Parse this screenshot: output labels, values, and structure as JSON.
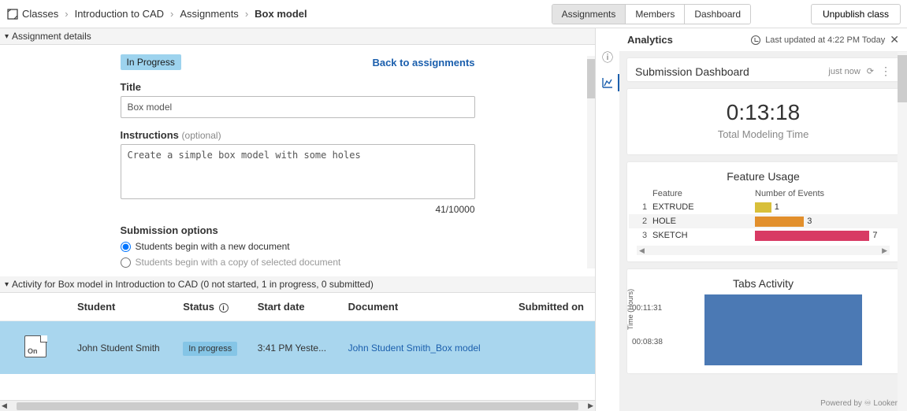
{
  "breadcrumb": {
    "root": "Classes",
    "course": "Introduction to CAD",
    "section": "Assignments",
    "current": "Box model"
  },
  "topTabs": {
    "assignments": "Assignments",
    "members": "Members",
    "dashboard": "Dashboard"
  },
  "unpublish": "Unpublish class",
  "sectionHeads": {
    "details": "Assignment details",
    "activity": "Activity for Box model in Introduction to CAD (0 not started, 1 in progress, 0 submitted)"
  },
  "details": {
    "status": "In Progress",
    "back": "Back to assignments",
    "titleLabel": "Title",
    "titleValue": "Box model",
    "instrLabel": "Instructions",
    "instrOpt": "(optional)",
    "instrValue": "Create a simple box model with some holes",
    "counter": "41/10000",
    "subOptsLabel": "Submission options",
    "radio1": "Students begin with a new document",
    "radio2": "Students begin with a copy of selected document"
  },
  "table": {
    "cols": {
      "student": "Student",
      "status": "Status",
      "start": "Start date",
      "document": "Document",
      "submitted": "Submitted on"
    },
    "row": {
      "student": "John Student Smith",
      "status": "In progress",
      "start": "3:41 PM Yeste...",
      "document": "John Student Smith_Box model"
    }
  },
  "analytics": {
    "title": "Analytics",
    "updated": "Last updated at 4:22 PM Today",
    "dash": {
      "title": "Submission Dashboard",
      "meta": "just now"
    },
    "time": {
      "value": "0:13:18",
      "label": "Total Modeling Time"
    },
    "feature": {
      "title": "Feature Usage",
      "colFeature": "Feature",
      "colEvents": "Number of Events"
    },
    "tabs": {
      "title": "Tabs Activity",
      "y1": "00:11:31",
      "y2": "00:08:38",
      "axis": "Time (Hours)"
    },
    "powered": "Powered by ♾ Looker"
  },
  "chart_data": {
    "type": "bar",
    "title": "Feature Usage",
    "xlabel": "Feature",
    "ylabel": "Number of Events",
    "categories": [
      "EXTRUDE",
      "HOLE",
      "SKETCH"
    ],
    "values": [
      1,
      3,
      7
    ],
    "colors": [
      "#d8bf3a",
      "#e28f2c",
      "#d83a64"
    ]
  }
}
